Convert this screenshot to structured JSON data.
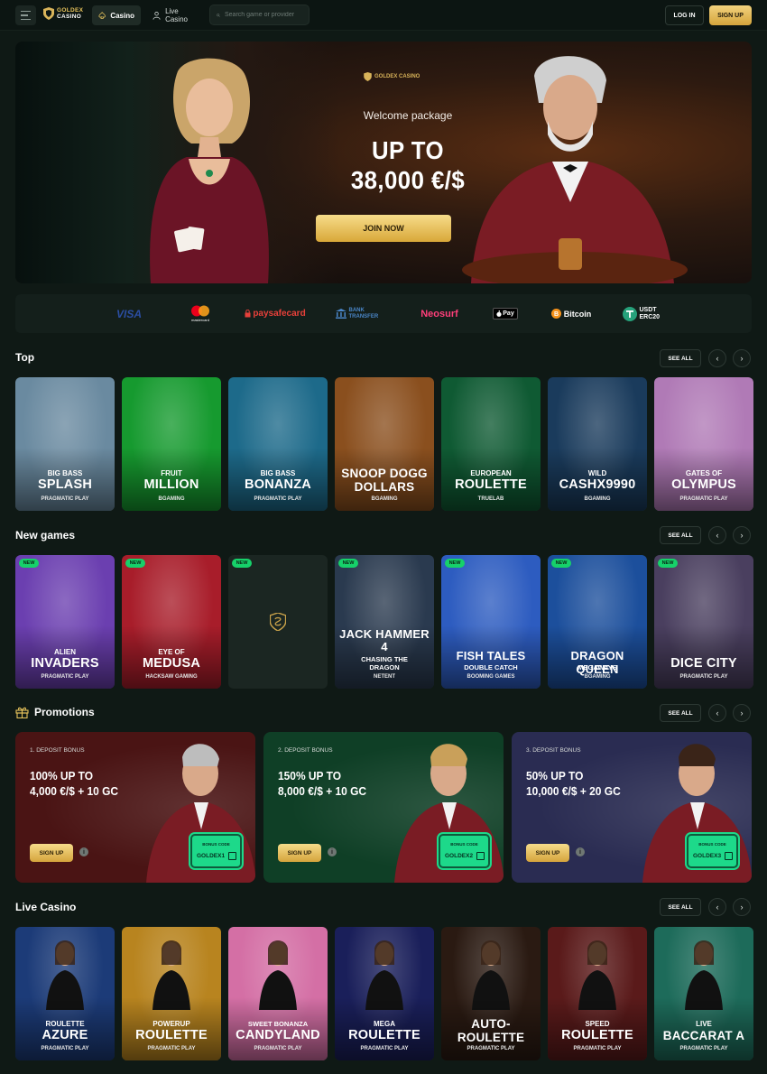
{
  "header": {
    "logo": {
      "line1": "GOLDEX",
      "line2": "CASINO"
    },
    "nav": [
      {
        "label": "Casino"
      },
      {
        "label": "Live Casino"
      }
    ],
    "search_placeholder": "Search game or provider",
    "login_label": "LOG IN",
    "signup_label": "SIGN UP"
  },
  "hero": {
    "logo": "GOLDEX CASINO",
    "subtitle": "Welcome package",
    "title_line1": "UP TO",
    "title_line2": "38,000 €/$",
    "cta": "JOIN NOW"
  },
  "payments": [
    {
      "name": "VISA",
      "color": "#2b4ea3"
    },
    {
      "name": "mastercard",
      "color": "#ffffff"
    },
    {
      "name": "paysafecard",
      "color": "#e8403a"
    },
    {
      "name": "BANK TRANSFER",
      "color": "#4a86c8"
    },
    {
      "name": "Neosurf",
      "color": "#ff3f7a"
    },
    {
      "name": "Pay",
      "color": "#ffffff"
    },
    {
      "name": "Bitcoin",
      "color": "#ffffff"
    },
    {
      "name": "USDT ERC20",
      "color": "#ffffff"
    }
  ],
  "sections": {
    "top": {
      "title": "Top",
      "see_all": "SEE ALL"
    },
    "new_games": {
      "title": "New games",
      "see_all": "SEE ALL"
    },
    "promotions": {
      "title": "Promotions",
      "see_all": "SEE ALL"
    },
    "live_casino": {
      "title": "Live Casino",
      "see_all": "SEE ALL"
    }
  },
  "top_games": [
    {
      "line1": "BIG BASS",
      "line2": "SPLASH",
      "provider": "PRAGMATIC PLAY",
      "bg": "#6a8aa0"
    },
    {
      "line1": "FRUIT",
      "line2": "MILLION",
      "provider": "BGAMING",
      "bg": "#169a2f"
    },
    {
      "line1": "BIG BASS",
      "line2": "BONANZA",
      "provider": "PRAGMATIC PLAY",
      "bg": "#1d6a8a"
    },
    {
      "line1": "",
      "line2": "SNOOP DOGG DOLLARS",
      "provider": "BGAMING",
      "bg": "#8a4f1e"
    },
    {
      "line1": "EUROPEAN",
      "line2": "ROULETTE",
      "provider": "TRUELAB",
      "bg": "#0f5a33"
    },
    {
      "line1": "WILD",
      "line2": "CASHX9990",
      "provider": "BGAMING",
      "bg": "#1a3b5c"
    },
    {
      "line1": "GATES OF",
      "line2": "OLYMPUS",
      "provider": "PRAGMATIC PLAY",
      "bg": "#b07ab6"
    }
  ],
  "new_games": [
    {
      "badge": "NEW",
      "line1": "ALIEN",
      "line2": "INVADERS",
      "line3": "",
      "provider": "PRAGMATIC PLAY",
      "bg": "#6b3fb0"
    },
    {
      "badge": "NEW",
      "line1": "EYE OF",
      "line2": "MEDUSA",
      "line3": "",
      "provider": "HACKSAW GAMING",
      "bg": "#a81d2a"
    },
    {
      "badge": "NEW",
      "line1": "",
      "line2": "",
      "line3": "",
      "provider": "",
      "bg": "#1b2622"
    },
    {
      "badge": "NEW",
      "line1": "",
      "line2": "JACK HAMMER 4",
      "line3": "CHASING THE DRAGON",
      "provider": "NETENT",
      "bg": "#2a3a4f"
    },
    {
      "badge": "NEW",
      "line1": "",
      "line2": "FISH TALES",
      "line3": "DOUBLE CATCH",
      "provider": "BOOMING GAMES",
      "bg": "#2d5cc0"
    },
    {
      "badge": "NEW",
      "line1": "",
      "line2": "DRAGON QUEEN",
      "line3": "MEGAWAYS",
      "provider": "BGAMING",
      "bg": "#1c4f9c"
    },
    {
      "badge": "NEW",
      "line1": "",
      "line2": "DICE CITY",
      "line3": "",
      "provider": "PRAGMATIC PLAY",
      "bg": "#4a3f5f"
    }
  ],
  "promotions": [
    {
      "label": "1. DEPOSIT BONUS",
      "line1": "100% UP TO",
      "line2": "4,000 €/$ + 10 GC",
      "button": "SIGN UP",
      "code_label": "BONUS CODE",
      "code": "GOLDEX1",
      "bg": "#4a1414"
    },
    {
      "label": "2. DEPOSIT BONUS",
      "line1": "150% UP TO",
      "line2": "8,000 €/$ + 10 GC",
      "button": "SIGN UP",
      "code_label": "BONUS CODE",
      "code": "GOLDEX2",
      "bg": "#0f3f26"
    },
    {
      "label": "3. DEPOSIT BONUS",
      "line1": "50% UP TO",
      "line2": "10,000 €/$ + 20 GC",
      "button": "SIGN UP",
      "code_label": "BONUS CODE",
      "code": "GOLDEX3",
      "bg": "#2a2c52"
    }
  ],
  "live_games": [
    {
      "line1": "ROULETTE",
      "line2": "AZURE",
      "provider": "PRAGMATIC PLAY",
      "bg": "#1c3b78"
    },
    {
      "line1": "POWERUP",
      "line2": "ROULETTE",
      "provider": "PRAGMATIC PLAY",
      "bg": "#b8841f"
    },
    {
      "line1": "SWEET BONANZA",
      "line2": "CANDYLAND",
      "provider": "PRAGMATIC PLAY",
      "bg": "#d46fa5"
    },
    {
      "line1": "MEGA",
      "line2": "ROULETTE",
      "provider": "PRAGMATIC PLAY",
      "bg": "#1a1f5a"
    },
    {
      "line1": "",
      "line2": "AUTO-ROULETTE",
      "provider": "PRAGMATIC PLAY",
      "bg": "#2a1a12"
    },
    {
      "line1": "SPEED",
      "line2": "ROULETTE",
      "provider": "PRAGMATIC PLAY",
      "bg": "#5a1a1a"
    },
    {
      "line1": "LIVE",
      "line2": "BACCARAT A",
      "provider": "PRAGMATIC PLAY",
      "bg": "#1d6b5a"
    }
  ]
}
